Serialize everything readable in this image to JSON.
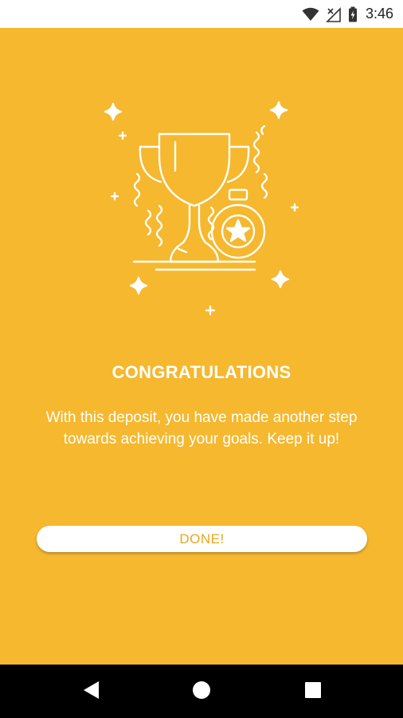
{
  "status_bar": {
    "time": "3:46",
    "icons": [
      "wifi-icon",
      "no-signal-icon",
      "battery-charging-icon"
    ]
  },
  "illustration": {
    "icons": [
      "trophy-icon",
      "medal-icon",
      "sparkle-icon",
      "confetti-icon"
    ]
  },
  "congrats": {
    "title": "CONGRATULATIONS",
    "message": "With this deposit, you have made another step towards achieving your goals. Keep it up!"
  },
  "actions": {
    "done_label": "DONE!"
  },
  "nav_bar": {
    "icons": [
      "back-icon",
      "home-icon",
      "recents-icon"
    ]
  },
  "colors": {
    "background": "#F5B82E",
    "button_text": "#E8A81C",
    "text": "#FFFFFF"
  }
}
